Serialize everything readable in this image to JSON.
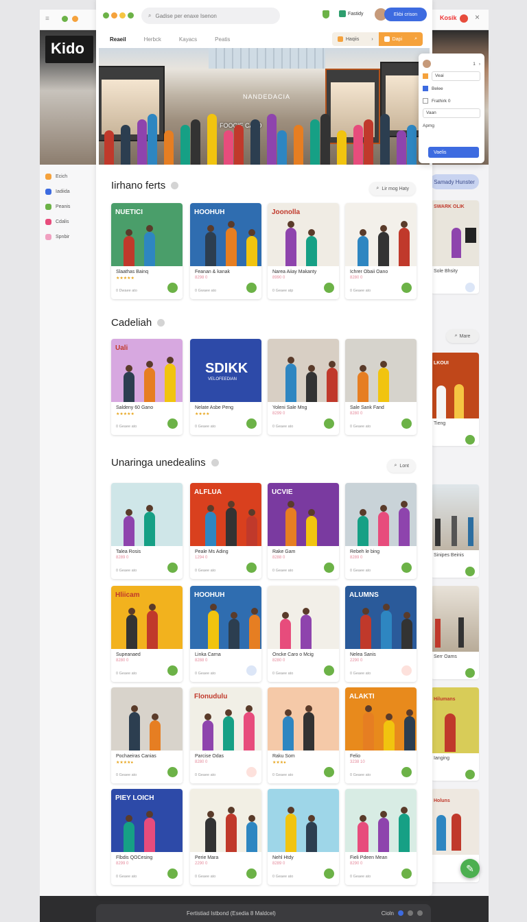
{
  "window": {
    "close_glyph": "×",
    "bg_logo": "Kido",
    "bg_brand": "Kosik"
  },
  "toolbar": {
    "search_placeholder": "Gadise per enaxe Isenon",
    "user_label": "Fastidy",
    "action_button": "Ekbi crison"
  },
  "tabs": [
    {
      "label": "Reaeil"
    },
    {
      "label": "Herbck"
    },
    {
      "label": "Kayacs"
    },
    {
      "label": "Peatis"
    }
  ],
  "tab_buttons": {
    "left": "Haqiis",
    "right": "Dapi"
  },
  "hero": {
    "sign": "NANDEDACIA",
    "overlay": "FOOCIE CALO"
  },
  "popup": {
    "rows": [
      "Veai",
      "Belee",
      "Frathirk 0",
      "Vaan",
      "Apmg"
    ],
    "top_count": "1",
    "button": "Vaelis"
  },
  "left_nav": [
    {
      "label": "Ecich"
    },
    {
      "label": "Iadiida"
    },
    {
      "label": "Peanis"
    },
    {
      "label": "Cdalis"
    },
    {
      "label": "Spnbir"
    }
  ],
  "sections": [
    {
      "title": "Iirhano ferts",
      "button": "Lir mog  Haty",
      "cards": [
        {
          "title": "Slaathas Bainq",
          "rating": "★★★★★",
          "meta": "0 Dwaee ato"
        },
        {
          "title": "Feanan & kanak",
          "rating": "8298 0",
          "meta": "0 Gwaee ato"
        },
        {
          "title": "Narea Aiiay Makanty",
          "rating": "8990 0",
          "meta": "0 Geaee atp"
        },
        {
          "title": "Ichrer  Obaii Oano",
          "rating": "8280 0",
          "meta": "0 Geaee ato"
        }
      ]
    },
    {
      "title": "Cadeliah",
      "button": "",
      "cards": [
        {
          "title": "Saldeny 60 Gano",
          "rating": "★★★★★",
          "meta": "0 Geaee ato"
        },
        {
          "title": "Nelate Asbe Peng",
          "rating": "★★★★",
          "meta": "0 Geaee ato"
        },
        {
          "title": "Yoleni Sale Mng",
          "rating": "8299 0",
          "meta": "0 Geaee ato"
        },
        {
          "title": "Sale Sank Fand",
          "rating": "8280 0",
          "meta": "0 Geaee ato"
        }
      ]
    },
    {
      "title": "Unaringa unedealins",
      "button": "Lont",
      "cards": [
        {
          "title": "Talea Rosis",
          "rating": "8289 0",
          "meta": "0 Geaee ato"
        },
        {
          "title": "Peale Ms Ading",
          "rating": "1294 0",
          "meta": "0 Geaee ato"
        },
        {
          "title": "Rake Gam",
          "rating": "8288 0",
          "meta": "0 Geaee ato"
        },
        {
          "title": "Rebeh le bing",
          "rating": "8289 0",
          "meta": "0 Geaee ato"
        },
        {
          "title": "Supeanaed",
          "rating": "8280 0",
          "meta": "0 Geaee ato"
        },
        {
          "title": "Linka Carna",
          "rating": "8288 0",
          "meta": "0 Geaee ato"
        },
        {
          "title": "Oncke Caro o Mcig",
          "rating": "8280 0",
          "meta": "0 Geaee ato"
        },
        {
          "title": "Nelea Sanis",
          "rating": "2290 0",
          "meta": "0 Geaee ato"
        },
        {
          "title": "Pochaeiras Canias",
          "rating": "★★★★●",
          "meta": "0 Geaee ato"
        },
        {
          "title": "Parcise Odas",
          "rating": "8280 0",
          "meta": "0 Geaee ato"
        },
        {
          "title": "Raku Som",
          "rating": "★★★●",
          "meta": "0 Geaee ato"
        },
        {
          "title": "Felio",
          "rating": "3238 10",
          "meta": "0 Geaee ato"
        },
        {
          "title": "Flbdis QOCesing",
          "rating": "8299 0",
          "meta": "0 Geaee ato"
        },
        {
          "title": "Perie Mara",
          "rating": "2290 0",
          "meta": "0 Geaee ato"
        },
        {
          "title": "Nehl Htdy",
          "rating": "8289 0",
          "meta": "0 Geaee ato"
        },
        {
          "title": "Fieli Pdeen Mean",
          "rating": "8290 0",
          "meta": "0 Geaee ato"
        }
      ]
    }
  ],
  "card_banners": {
    "s1c1": "NUETICI",
    "s1c2": "HOOHUH",
    "s1c3": "Joonolla",
    "s2c1": "Uali",
    "s2c2": "SDIKK",
    "s2c2_sub": "VELOFEEDIAN",
    "s3c2": "ALFLUA",
    "s3c3": "UCVIE",
    "s3c5": "Hliicam",
    "s3c6": "HOOHUH",
    "s3c8": "ALUMNS",
    "s3c10": "Flonudulu",
    "s3c12": "ALAKTI",
    "s3c13": "PIEY LOICH"
  },
  "right_peek": {
    "pill": "Samady Hunster",
    "pill2": "Mare",
    "cards": [
      {
        "title": "Sole Bhsity"
      },
      {
        "title": "Tieng"
      },
      {
        "title": "Sinipes Beinis"
      },
      {
        "title": "Serr Oams"
      },
      {
        "title": "Ianging"
      },
      {
        "title": ""
      }
    ],
    "banners": [
      "SWARK OLIK",
      "LKOUI",
      "Hilumans",
      "Holuns"
    ]
  },
  "bottom": {
    "status": "Fertistiad Istbond (Esedia 8 Maldcel)",
    "right": "Cioln"
  },
  "colors": {
    "accent_blue": "#3d6be0",
    "accent_green": "#6cb247",
    "accent_orange": "#f5a23c"
  }
}
